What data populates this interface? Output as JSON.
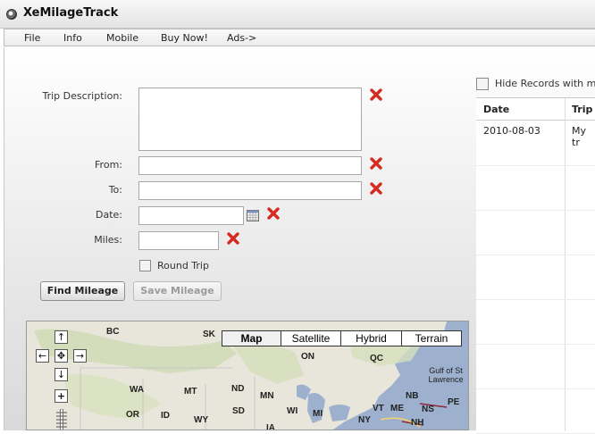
{
  "window": {
    "title": "XeMilageTrack"
  },
  "menu": [
    "File",
    "Info",
    "Mobile",
    "Buy Now!",
    "Ads->"
  ],
  "form": {
    "trip_description_label": "Trip Description:",
    "from_label": "From:",
    "to_label": "To:",
    "date_label": "Date:",
    "miles_label": "Miles:",
    "round_trip_label": "Round Trip",
    "round_trip_checked": false,
    "trip_description_value": "",
    "from_value": "",
    "to_value": "",
    "date_value": "",
    "miles_value": ""
  },
  "buttons": {
    "find_mileage": "Find Mileage",
    "save_mileage": "Save Mileage"
  },
  "map": {
    "types": [
      "Map",
      "Satellite",
      "Hybrid",
      "Terrain"
    ],
    "selected_type": "Map",
    "labels": {
      "bc": "BC",
      "sk": "SK",
      "on": "ON",
      "qc": "QC",
      "gulf": "Gulf of St Lawrence",
      "wa": "WA",
      "mt": "MT",
      "nd": "ND",
      "mn": "MN",
      "nb": "NB",
      "pe": "PE",
      "ns": "NS",
      "or": "OR",
      "id": "ID",
      "wy": "WY",
      "sd": "SD",
      "wi": "WI",
      "mi": "MI",
      "vt": "VT",
      "me": "ME",
      "ny": "NY",
      "nh": "NH",
      "ia": "IA"
    }
  },
  "records": {
    "hide_label": "Hide Records with m",
    "columns": [
      "Date",
      "Trip"
    ],
    "rows": [
      {
        "date": "2010-08-03",
        "trip": "My tr"
      }
    ]
  },
  "colors": {
    "delete_icon": "#d42a20",
    "water": "#9db1cf",
    "land": "#e9e6dc"
  }
}
